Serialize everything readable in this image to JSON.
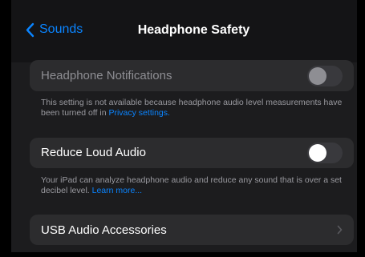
{
  "nav": {
    "back_label": "Sounds",
    "title": "Headphone Safety"
  },
  "headphone_notifications": {
    "label": "Headphone Notifications",
    "enabled": false,
    "available": false,
    "footnote": "This setting is not available because headphone audio level measurements have been turned off in ",
    "footnote_link": "Privacy settings."
  },
  "reduce_loud_audio": {
    "label": "Reduce Loud Audio",
    "enabled": false,
    "footnote": "Your iPad can analyze headphone audio and reduce any sound that is over a set decibel level. ",
    "footnote_link": "Learn more..."
  },
  "usb_audio": {
    "label": "USB Audio Accessories"
  },
  "colors": {
    "accent": "#0a84ff",
    "background": "#1c1c1e",
    "cell": "#2c2c2e",
    "disabled_text": "#8e8e93"
  },
  "icons": {
    "back": "chevron-left-icon",
    "disclosure": "chevron-right-icon"
  }
}
